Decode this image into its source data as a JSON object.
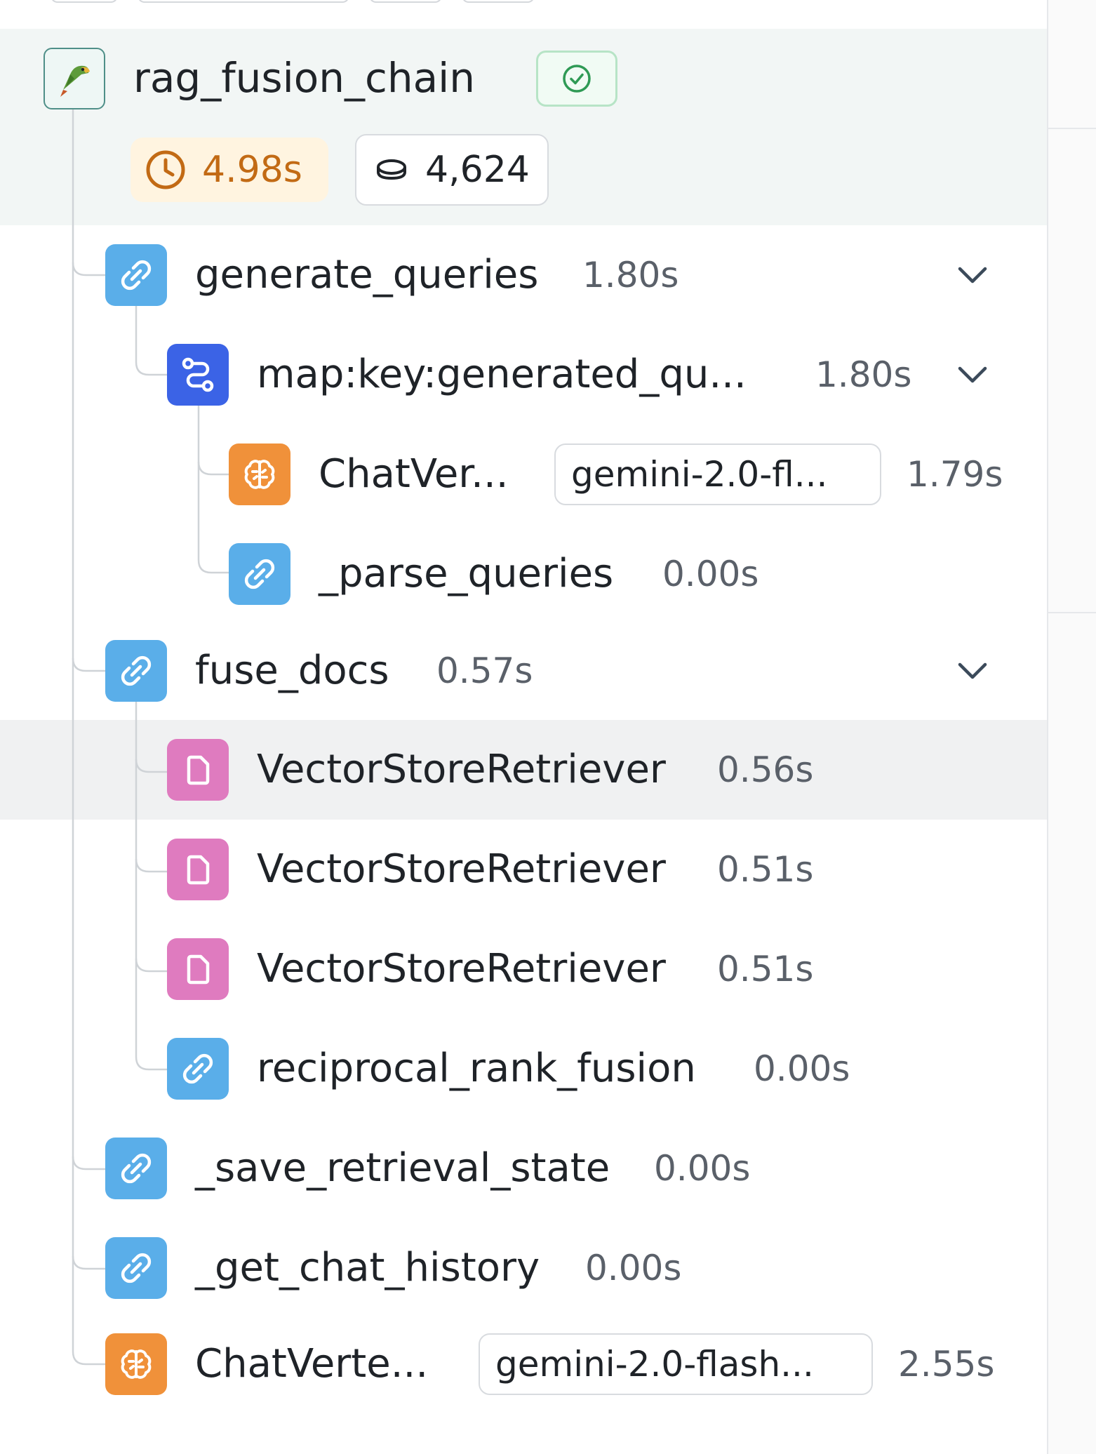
{
  "root": {
    "name": "rag_fusion_chain",
    "status": "success",
    "latency": "4.98s",
    "tokens": "4,624",
    "icon": "parrot-icon"
  },
  "runs": [
    {
      "name": "generate_queries",
      "time": "1.80s",
      "icon": "chain-link-icon",
      "depth": 1,
      "expandable": true
    },
    {
      "name": "map:key:generated_qu...",
      "time": "1.80s",
      "icon": "map-route-icon",
      "depth": 2,
      "expandable": true
    },
    {
      "name": "ChatVer...",
      "model": "gemini-2.0-fl...",
      "time": "1.79s",
      "icon": "brain-icon",
      "depth": 3,
      "expandable": false
    },
    {
      "name": "_parse_queries",
      "time": "0.00s",
      "icon": "chain-link-icon",
      "depth": 3,
      "expandable": false
    },
    {
      "name": "fuse_docs",
      "time": "0.57s",
      "icon": "chain-link-icon",
      "depth": 1,
      "expandable": true
    },
    {
      "name": "VectorStoreRetriever",
      "time": "0.56s",
      "icon": "document-icon",
      "depth": 2,
      "expandable": false,
      "highlighted": true
    },
    {
      "name": "VectorStoreRetriever",
      "time": "0.51s",
      "icon": "document-icon",
      "depth": 2,
      "expandable": false
    },
    {
      "name": "VectorStoreRetriever",
      "time": "0.51s",
      "icon": "document-icon",
      "depth": 2,
      "expandable": false
    },
    {
      "name": "reciprocal_rank_fusion",
      "time": "0.00s",
      "icon": "chain-link-icon",
      "depth": 2,
      "expandable": false
    },
    {
      "name": "_save_retrieval_state",
      "time": "0.00s",
      "icon": "chain-link-icon",
      "depth": 1,
      "expandable": false
    },
    {
      "name": "_get_chat_history",
      "time": "0.00s",
      "icon": "chain-link-icon",
      "depth": 1,
      "expandable": false
    },
    {
      "name": "ChatVerte...",
      "model": "gemini-2.0-flash...",
      "time": "2.55s",
      "icon": "brain-icon",
      "depth": 1,
      "expandable": false
    }
  ],
  "colors": {
    "chain": "#5aaee9",
    "map": "#3b63e6",
    "llm": "#f0913a",
    "retriever": "#df7bbf",
    "latency_text": "#c26a14",
    "success": "#2f9a55"
  }
}
